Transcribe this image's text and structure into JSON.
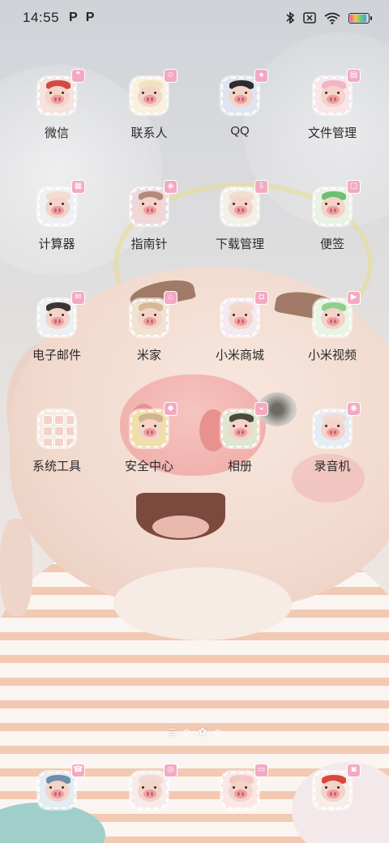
{
  "status_bar": {
    "time": "14:55",
    "notifications": [
      "P",
      "P"
    ],
    "icons": [
      "bluetooth-icon",
      "no-sim-icon",
      "wifi-icon",
      "battery-charging-icon"
    ],
    "battery_level": 0.9
  },
  "apps": [
    {
      "label": "微信",
      "hair": "#d14a44",
      "bg": "#f6e3dd",
      "badge": "chat-icon"
    },
    {
      "label": "联系人",
      "hair": "#f2e2bd",
      "bg": "#f9f0df",
      "badge": "person-icon"
    },
    {
      "label": "QQ",
      "hair": "#2e2c30",
      "bg": "#dfe4f0",
      "badge": "penguin-icon"
    },
    {
      "label": "文件管理",
      "hair": "#f2b4c8",
      "bg": "#f8e6ea",
      "badge": "folder-icon"
    },
    {
      "label": "计算器",
      "hair": "#f4dcd2",
      "bg": "#eef0f4",
      "badge": "calculator-icon"
    },
    {
      "label": "指南针",
      "hair": "#b48a7c",
      "bg": "#efd8dc",
      "badge": "compass-icon"
    },
    {
      "label": "下载管理",
      "hair": "#f1ddd2",
      "bg": "#f2f0e8",
      "badge": "download-icon"
    },
    {
      "label": "便签",
      "hair": "#6fbf73",
      "bg": "#e9f2e4",
      "badge": "note-icon"
    },
    {
      "label": "电子邮件",
      "hair": "#3a3433",
      "bg": "#eceff3",
      "badge": "mail-icon"
    },
    {
      "label": "米家",
      "hair": "#d6b898",
      "bg": "#f0e3d3",
      "badge": "home-icon"
    },
    {
      "label": "小米商城",
      "hair": "#f3d8d0",
      "bg": "#f3eaf2",
      "badge": "bag-icon"
    },
    {
      "label": "小米视频",
      "hair": "#8fcf8a",
      "bg": "#eaf4e4",
      "badge": "video-icon"
    },
    {
      "label": "系统工具",
      "hair": "",
      "bg": "",
      "badge": "",
      "folder": true
    },
    {
      "label": "安全中心",
      "hair": "#d2b48e",
      "bg": "#f0dfa8",
      "badge": "shield-icon"
    },
    {
      "label": "相册",
      "hair": "#4b4a3c",
      "bg": "#dfe6cf",
      "badge": "photo-icon"
    },
    {
      "label": "录音机",
      "hair": "#f3dcd6",
      "bg": "#e5ecf6",
      "badge": "mic-icon"
    }
  ],
  "dock": [
    {
      "hair": "#6f8ea8",
      "bg": "#e3edf3",
      "badge": "phone-icon"
    },
    {
      "hair": "#f2d9cf",
      "bg": "#f7ecea",
      "badge": "browser-icon"
    },
    {
      "hair": "#f2c8c0",
      "bg": "#fbe7e5",
      "badge": "message-icon"
    },
    {
      "hair": "#d9473d",
      "bg": "#f7eeea",
      "badge": "camera-icon"
    }
  ],
  "page_indicator": {
    "pages": 3,
    "current": 2
  }
}
